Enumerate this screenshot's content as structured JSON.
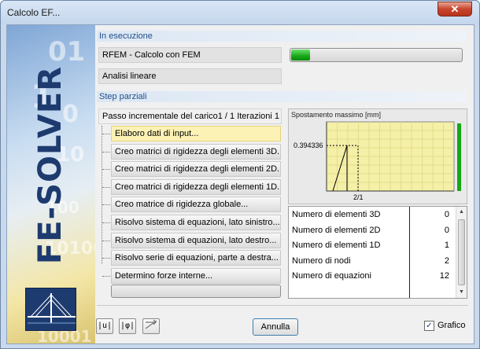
{
  "window": {
    "title": "Calcolo EF...",
    "close_glyph": "✕"
  },
  "banner": {
    "text": "FE-SOLVER",
    "digits": [
      "01",
      "1",
      "0",
      "10",
      "0001",
      "101000",
      "01",
      "1",
      "100",
      "10001",
      "1"
    ]
  },
  "running": {
    "title": "In esecuzione",
    "task": "RFEM - Calcolo con FEM",
    "analysis": "Analisi lineare",
    "progress_fraction": 0.12
  },
  "steps": {
    "title": "Step parziali",
    "header": "Passo incrementale del carico1 / 1 Iterazioni 1",
    "items": [
      "Elaboro dati di input...",
      "Creo matrici di rigidezza degli elementi 3D...",
      "Creo matrici di rigidezza degli elementi 2D...",
      "Creo matrici di rigidezza degli elementi 1D...",
      "Creo matrice di rigidezza globale...",
      "Risolvo sistema di equazioni, lato sinistro...",
      "Risolvo sistema di equazioni, lato destro...",
      "Risolvo serie di equazioni, parte a destra...",
      "Determino forze interne..."
    ],
    "active_index": 0,
    "step_progress_fraction": 0.0
  },
  "chart_data": {
    "type": "line",
    "title": "Spostamento massimo [mm]",
    "x_tick_label": "2/1",
    "y_value_label": "0.394336",
    "x": [
      0,
      1,
      1
    ],
    "y": [
      0,
      0.394336,
      0
    ],
    "grid": true
  },
  "stats": {
    "rows": [
      {
        "label": "Numero di elementi 3D",
        "value": "0"
      },
      {
        "label": "Numero di elementi 2D",
        "value": "0"
      },
      {
        "label": "Numero di elementi 1D",
        "value": "1"
      },
      {
        "label": "Numero di nodi",
        "value": "2"
      },
      {
        "label": "Numero di equazioni",
        "value": "12"
      }
    ]
  },
  "footer": {
    "icon_u": "|u|",
    "icon_phi": "|φ|",
    "cancel_label": "Annulla",
    "graph_label": "Grafico",
    "graph_checked": true,
    "check_glyph": "✓"
  },
  "colors": {
    "progress_green": "#16a716",
    "chart_yellow_grid": "#f5f0a8",
    "banner_blue": "#1d3b6f"
  }
}
